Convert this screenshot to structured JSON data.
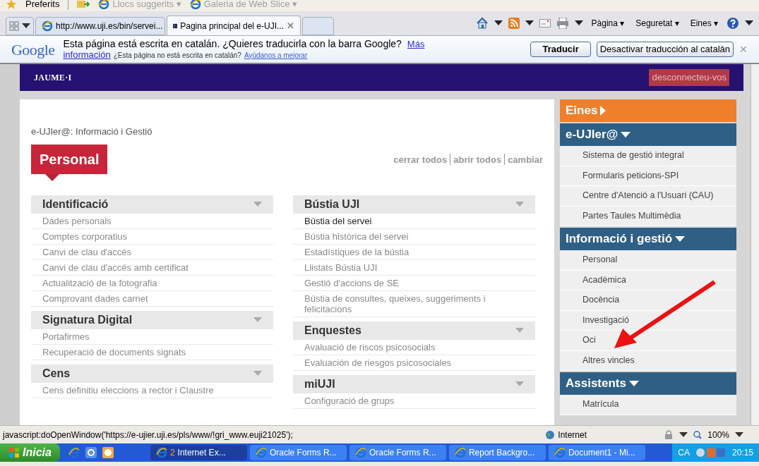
{
  "favorites_bar": {
    "favorites": "Preferits",
    "links": [
      {
        "label": "Llocs suggerits ▾",
        "disabled": true
      },
      {
        "label": "Galeria de Web Slice ▾",
        "disabled": true
      }
    ]
  },
  "tabs": [
    {
      "label": "http://www.uji.es/bin/servei...",
      "selected": false,
      "kind": "ie"
    },
    {
      "label": "Pagina principal del e-UJI...",
      "selected": true,
      "kind": "uji"
    }
  ],
  "command_bar": [
    "Pàgina ▾",
    "Seguretat ▾",
    "Eines ▾"
  ],
  "translate_bar": {
    "logo": "Google",
    "message": "Esta página está escrita en catalán. ¿Quieres traducirla con la barra Google?",
    "more_link": "Más",
    "more_link_2": "información",
    "question": "¿Esta página no está escrita en catalán?",
    "help_link": "Ayúdanos a mejorar",
    "buttons": [
      "Traducir",
      "Desactivar traducción al catalán"
    ],
    "close": "✕"
  },
  "site_header": {
    "logo": "JAUME·I",
    "logout": "desconnecteu-vos"
  },
  "main": {
    "breadcrumb": "e-UJIer@: Informació i Gestió",
    "title": "Personal",
    "actions": [
      "cerrar todos",
      "abrir todos",
      "cambiar"
    ],
    "columns": [
      [
        {
          "title": "Identificació",
          "items": [
            {
              "label": "Dades personals",
              "emphasis": false
            },
            {
              "label": "Comptes corporatius",
              "emphasis": false
            },
            {
              "label": "Canvi de clau d'accés",
              "emphasis": false
            },
            {
              "label": "Canvi de clau d'accés amb certificat",
              "emphasis": false
            },
            {
              "label": "Actualització de la fotografia",
              "emphasis": false
            },
            {
              "label": "Comprovant dades carnet",
              "emphasis": false
            }
          ]
        },
        {
          "title": "Signatura Digital",
          "items": [
            {
              "label": "Portafirmes",
              "emphasis": false
            },
            {
              "label": "Recuperació de documents signats",
              "emphasis": false
            }
          ]
        },
        {
          "title": "Cens",
          "items": [
            {
              "label": "Cens definitiu eleccions a rector i Claustre",
              "emphasis": false
            }
          ]
        }
      ],
      [
        {
          "title": "Bústia UJI",
          "items": [
            {
              "label": "Bústia del servei",
              "emphasis": true
            },
            {
              "label": "Bústia històrica del servei",
              "emphasis": false
            },
            {
              "label": "Estadístiques de la bústia",
              "emphasis": false
            },
            {
              "label": "Llistats Bústia UJI",
              "emphasis": false
            },
            {
              "label": "Gestió d'accions de SE",
              "emphasis": false
            },
            {
              "label": "Bústia de consultes, queixes, suggeriments i felicitacions",
              "emphasis": false
            }
          ]
        },
        {
          "title": "Enquestes",
          "items": [
            {
              "label": "Avaluació de riscos psicosocials",
              "emphasis": false
            },
            {
              "label": "Evaluación de riesgos psicosociales",
              "emphasis": false
            }
          ]
        },
        {
          "title": "miUJI",
          "items": [
            {
              "label": "Configuració de grups",
              "emphasis": false
            }
          ]
        }
      ]
    ]
  },
  "sidebar": [
    {
      "title": "Eines",
      "expanded": false,
      "color": "#f07f2c"
    },
    {
      "title": "e-UJIer@",
      "expanded": true,
      "color": "#2f5f84",
      "items": [
        "Sistema de gestió integral",
        "Formularis peticions-SPI",
        "Centre d'Atenció a l'Usuari (CAU)",
        "Partes Taules Multimèdia"
      ]
    },
    {
      "title": "Informació i gestió",
      "expanded": true,
      "color": "#2f5f84",
      "items": [
        "Personal",
        "Acadèmica",
        "Docència",
        "Investigació",
        "Oci",
        "Altres vincles"
      ]
    },
    {
      "title": "Assistents",
      "expanded": true,
      "color": "#2f5f84",
      "items": [
        "Matrícula"
      ]
    }
  ],
  "status_bar": {
    "url": "javascript:doOpenWindow('https://e-ujier.uji.es/pls/www/!gri_www.euji21025');",
    "zone": "Internet",
    "zoom": "100%"
  },
  "taskbar": {
    "start": "Inicia",
    "tasks": [
      {
        "count": "2",
        "label": "Internet Ex...",
        "selected": true
      },
      {
        "label": "Oracle Forms R...",
        "selected": false
      },
      {
        "label": "Oracle Forms R...",
        "selected": false
      },
      {
        "label": "Report Backgro...",
        "selected": false
      },
      {
        "label": "Document1 - Mi...",
        "selected": false
      }
    ],
    "language": "CA",
    "clock": "20:15"
  }
}
